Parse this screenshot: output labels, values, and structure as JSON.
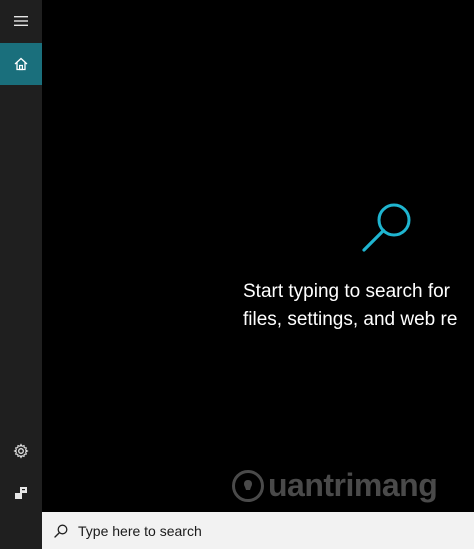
{
  "sidebar": {
    "menu_icon": "hamburger-icon",
    "home_icon": "home-icon",
    "settings_icon": "gear-icon",
    "feedback_icon": "feedback-icon"
  },
  "main": {
    "hint_line1": "Start typing to search for",
    "hint_line2": "files, settings, and web re",
    "search_graphic_icon": "magnifier-icon",
    "accent_color": "#1fb5d0"
  },
  "watermark": {
    "text": "uantrimang"
  },
  "searchbar": {
    "placeholder": "Type here to search",
    "icon": "search-icon"
  }
}
